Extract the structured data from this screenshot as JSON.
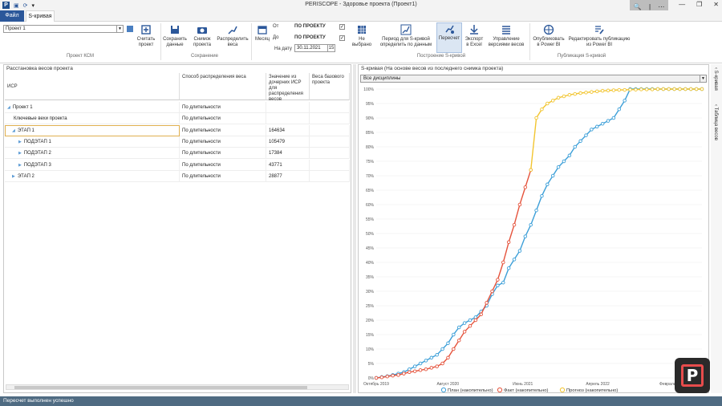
{
  "window": {
    "app_title": "PERISCOPE - Здоровье проекта (Проект1)",
    "controls": [
      "—",
      "❐",
      "✕"
    ],
    "zoom_controls": [
      "🔍",
      "|",
      "⋯"
    ]
  },
  "tabs": [
    {
      "label": "Файл"
    },
    {
      "label": "S-кривая"
    }
  ],
  "ribbon": {
    "project_select": "Проект 1",
    "btn_read": "Считать проект",
    "group_ksm": "Проект КСМ",
    "btn_save_data": "Сохранить данные",
    "btn_snapshot": "Снимок проекта",
    "btn_distribute": "Распределить веса",
    "group_save": "Сохранение",
    "btn_month": "Месяц",
    "from_label": "От",
    "to_label": "До",
    "from_value": "ПО ПРОЕКТУ",
    "to_value": "ПО ПРОЕКТУ",
    "on_date_label": "На дату",
    "on_date_value": "30.11.2021",
    "calendar_day": "15",
    "btn_not_selected": "Не выбрано",
    "btn_period": "Период для S-кривой определить по данным",
    "btn_recalc": "Пересчет",
    "btn_export": "Экспорт в Excel",
    "btn_versions": "Управление версиями весов",
    "group_build": "Построение S-кривой",
    "btn_publish": "Опубликовать в Power BI",
    "btn_edit_pub": "Редактировать публикацию из Power BI",
    "group_publish": "Публикация S-кривой"
  },
  "left_panel": {
    "title": "Расстановка весов проекта",
    "columns": [
      "ИСР",
      "Способ распределения веса",
      "Значение из дочерних ИСР для распределения весов",
      "Веса базового проекта"
    ],
    "rows": [
      {
        "name": "Проект 1",
        "method": "По длительности",
        "value": "",
        "tri": "◢"
      },
      {
        "name": "Ключевые вехи проекта",
        "method": "По длительности",
        "value": "",
        "tri": ""
      },
      {
        "name": "ЭТАП 1",
        "method": "По длительности",
        "value": "164634",
        "tri": "◢"
      },
      {
        "name": "ПОДЭТАП 1",
        "method": "По длительности",
        "value": "105479",
        "tri": "▶"
      },
      {
        "name": "ПОДЭТАП 2",
        "method": "По длительности",
        "value": "17384",
        "tri": "▶"
      },
      {
        "name": "ПОДЭТАП 3",
        "method": "По длительности",
        "value": "43771",
        "tri": "▶"
      },
      {
        "name": "ЭТАП 2",
        "method": "По длительности",
        "value": "28877",
        "tri": "▶"
      }
    ]
  },
  "right_panel": {
    "title": "S-кривая (На основе весов из последнего снимка проекта)",
    "discipline_select": "Все дисциплины"
  },
  "side_tabs": [
    "S-кривая",
    "Таблица весов"
  ],
  "status": "Пересчет выполнен успешно",
  "brand_letter": "P",
  "chart_data": {
    "type": "line",
    "x_ticks": [
      "Октябрь 2019",
      "Август 2020",
      "Июнь 2021",
      "Апрель 2022",
      "Февраль 2023"
    ],
    "y_ticks": [
      "0%",
      "5%",
      "10%",
      "15%",
      "20%",
      "25%",
      "30%",
      "35%",
      "40%",
      "45%",
      "50%",
      "55%",
      "60%",
      "65%",
      "70%",
      "75%",
      "80%",
      "85%",
      "90%",
      "95%",
      "100%"
    ],
    "ylim": [
      0,
      100
    ],
    "series": [
      {
        "name": "План (накопительно)",
        "color": "#3c9fd8",
        "values": [
          0,
          0.3,
          0.6,
          1,
          1.5,
          2,
          3,
          4,
          5,
          6,
          7,
          8,
          10,
          12,
          15,
          17.5,
          19,
          20,
          21,
          23,
          25,
          29,
          32,
          33,
          38,
          41,
          44,
          49,
          53,
          58,
          63,
          67,
          70,
          73,
          75,
          77,
          80,
          82,
          84,
          86,
          87,
          88,
          89,
          90,
          93,
          96,
          100,
          100,
          100,
          100,
          100,
          100,
          100,
          100,
          100,
          100,
          100,
          100,
          100,
          100
        ]
      },
      {
        "name": "Факт (накопительно)",
        "color": "#e5533c",
        "values": [
          0,
          0.2,
          0.5,
          0.8,
          1,
          1.5,
          2,
          2.3,
          2.7,
          3,
          3.5,
          4,
          5,
          7,
          10,
          13,
          16,
          18,
          20,
          22,
          26,
          30,
          34,
          40,
          47,
          53,
          60,
          66,
          72
        ]
      },
      {
        "name": "Прогноз (накопительно)",
        "color": "#f2c530",
        "values": [
          null,
          null,
          null,
          null,
          null,
          null,
          null,
          null,
          null,
          null,
          null,
          null,
          null,
          null,
          null,
          null,
          null,
          null,
          null,
          null,
          null,
          null,
          null,
          null,
          null,
          null,
          null,
          null,
          72,
          90,
          93,
          95,
          96,
          97,
          97.5,
          98,
          98.3,
          98.6,
          98.8,
          99,
          99.2,
          99.4,
          99.5,
          99.6,
          99.7,
          99.7,
          99.8,
          99.8,
          99.9,
          99.9,
          99.9,
          100,
          100,
          100,
          100,
          100,
          100,
          100,
          100,
          100
        ]
      }
    ]
  }
}
